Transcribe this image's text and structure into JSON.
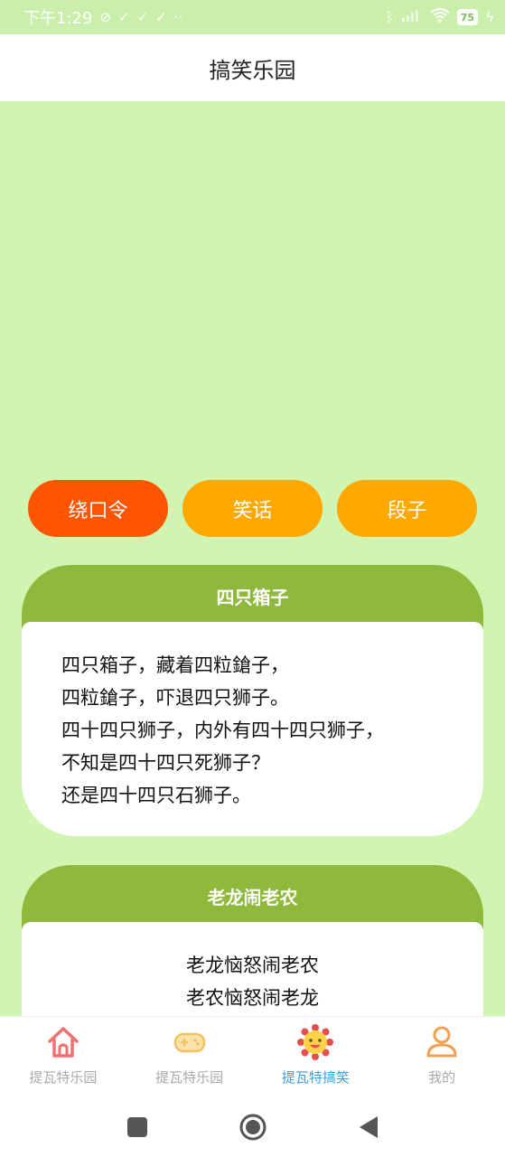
{
  "status": {
    "time": "下午1:29",
    "battery": "75"
  },
  "header": {
    "title": "搞笑乐园"
  },
  "categories": [
    {
      "label": "绕口令",
      "active": true
    },
    {
      "label": "笑话",
      "active": false
    },
    {
      "label": "段子",
      "active": false
    }
  ],
  "cards": [
    {
      "title": "四只箱子",
      "lines": [
        "四只箱子，藏着四粒鎗子，",
        "四粒鎗子，吓退四只狮子。",
        "四十四只狮子，内外有四十四只狮子，",
        "不知是四十四只死狮子？",
        "还是四十四只石狮子。"
      ]
    },
    {
      "title": "老龙闹老农",
      "lines": [
        "老龙恼怒闹老农",
        "老农恼怒闹老龙"
      ]
    }
  ],
  "nav": [
    {
      "label": "提瓦特乐园",
      "icon": "home-icon",
      "color": "#f07070"
    },
    {
      "label": "提瓦特乐园",
      "icon": "gamepad-icon",
      "color": "#f2c060"
    },
    {
      "label": "提瓦特搞笑",
      "icon": "sun-face-icon",
      "color": "#e84d4d"
    },
    {
      "label": "我的",
      "icon": "user-icon",
      "color": "#f0a050"
    }
  ],
  "colors": {
    "background": "#d0f5b0",
    "accent_active": "#ff5500",
    "accent": "#ffa800",
    "card_head": "#8fb93c",
    "nav_active": "#3aa0e0"
  }
}
